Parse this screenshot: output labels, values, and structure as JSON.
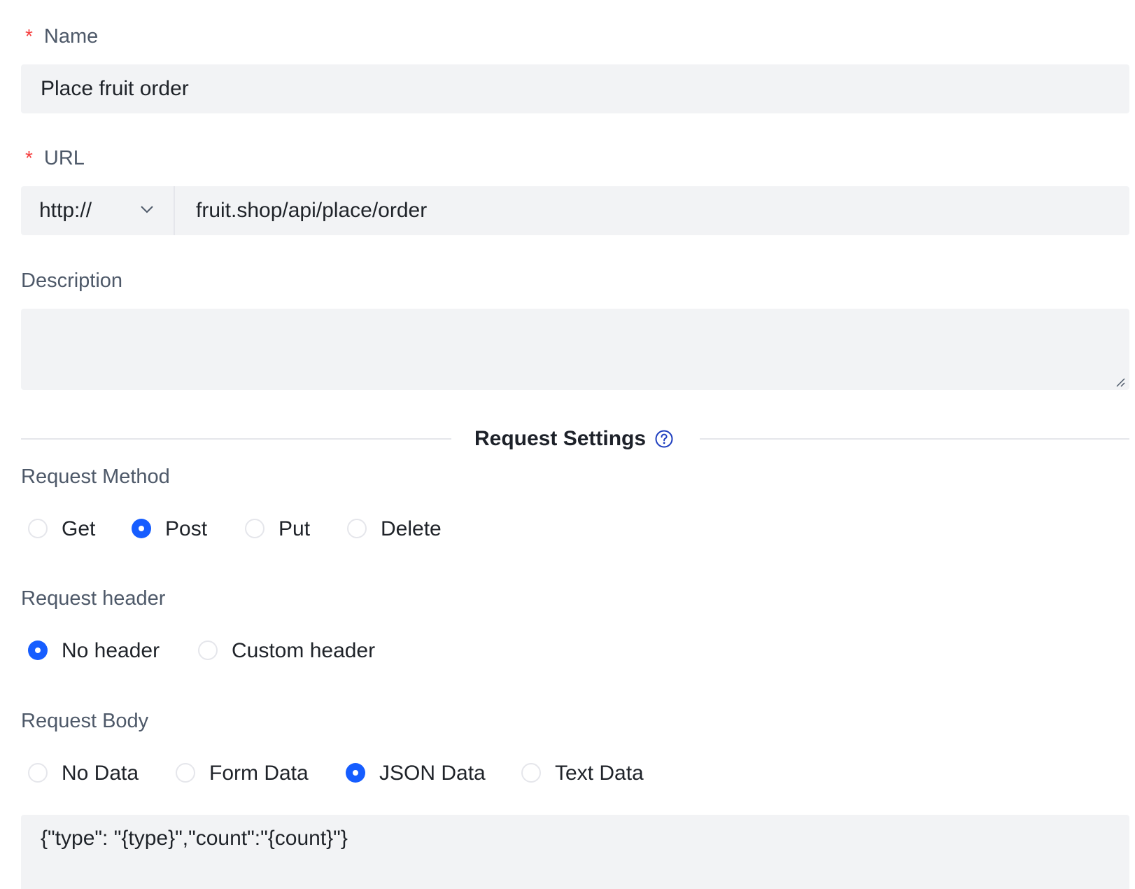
{
  "name_field": {
    "required_mark": "*",
    "label": "Name",
    "value": "Place fruit order"
  },
  "url_field": {
    "required_mark": "*",
    "label": "URL",
    "protocol": "http://",
    "value": "fruit.shop/api/place/order"
  },
  "description_field": {
    "label": "Description",
    "value": ""
  },
  "request_settings": {
    "title": "Request Settings",
    "help_icon": "question-circle-icon"
  },
  "request_method": {
    "label": "Request Method",
    "options": [
      "Get",
      "Post",
      "Put",
      "Delete"
    ],
    "selected": "Post"
  },
  "request_header": {
    "label": "Request header",
    "options": [
      "No header",
      "Custom header"
    ],
    "selected": "No header"
  },
  "request_body": {
    "label": "Request Body",
    "options": [
      "No Data",
      "Form Data",
      "JSON Data",
      "Text Data"
    ],
    "selected": "JSON Data",
    "value": "{\"type\": \"{type}\",\"count\":\"{count}\"}"
  },
  "colors": {
    "accent": "#165dff",
    "required": "#f53f3f",
    "input_bg": "#f2f3f5"
  }
}
